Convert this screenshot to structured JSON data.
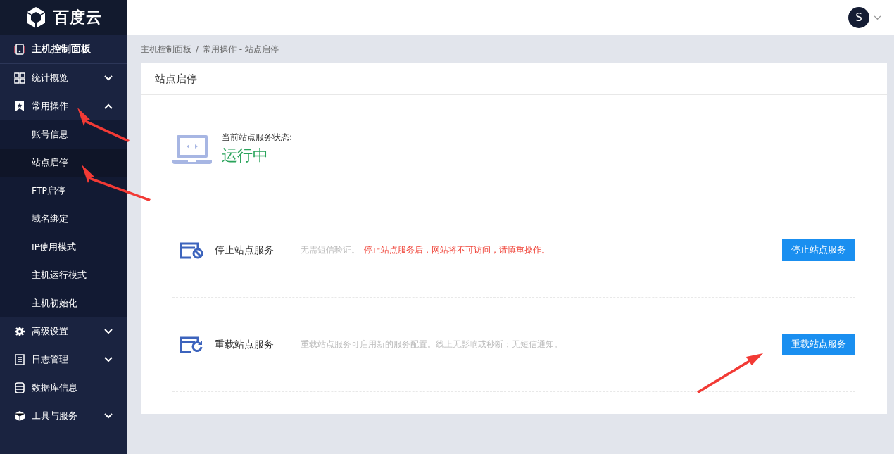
{
  "logo": {
    "text": "百度云"
  },
  "sidebar": {
    "items": [
      {
        "kind": "link",
        "label": "主机控制面板"
      },
      {
        "kind": "group",
        "label": "统计概览",
        "expanded": false
      },
      {
        "kind": "group",
        "label": "常用操作",
        "expanded": true,
        "children": [
          {
            "label": "账号信息",
            "selected": false
          },
          {
            "label": "站点启停",
            "selected": true
          },
          {
            "label": "FTP启停",
            "selected": false
          },
          {
            "label": "域名绑定",
            "selected": false
          },
          {
            "label": "IP使用模式",
            "selected": false
          },
          {
            "label": "主机运行模式",
            "selected": false
          },
          {
            "label": "主机初始化",
            "selected": false
          }
        ]
      },
      {
        "kind": "group",
        "label": "高级设置",
        "expanded": false
      },
      {
        "kind": "group",
        "label": "日志管理",
        "expanded": false
      },
      {
        "kind": "link",
        "label": "数据库信息"
      },
      {
        "kind": "group",
        "label": "工具与服务",
        "expanded": false
      }
    ]
  },
  "user": {
    "initial": "S"
  },
  "breadcrumb": {
    "path": "主机控制面板",
    "separator": "/",
    "current": "常用操作 - 站点启停"
  },
  "panel": {
    "title": "站点启停",
    "status_label": "当前站点服务状态:",
    "status": "运行中",
    "actions": [
      {
        "kind": "stop",
        "title": "停止站点服务",
        "note": "无需短信验证。",
        "warning": "停止站点服务后，网站将不可访问，请慎重操作。",
        "button": "停止站点服务"
      },
      {
        "kind": "reload",
        "title": "重载站点服务",
        "note": "重载站点服务可启用新的服务配置。线上无影响或秒断；无短信通知。",
        "button": "重载站点服务"
      }
    ]
  }
}
